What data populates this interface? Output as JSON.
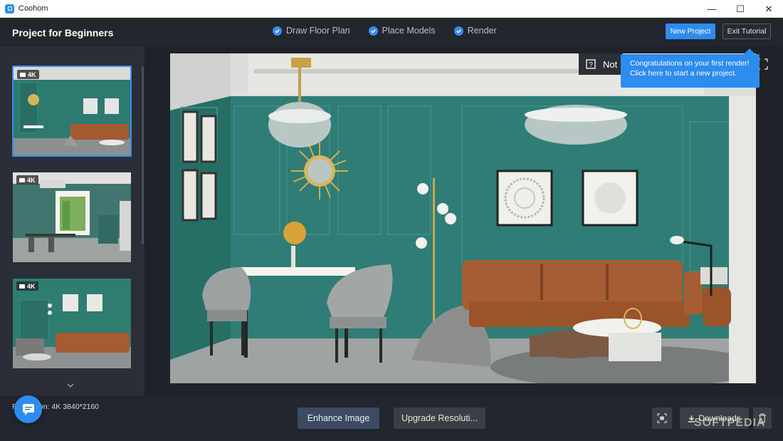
{
  "window": {
    "app_name": "Coohom",
    "minimize": "—",
    "maximize": "☐",
    "close": "✕"
  },
  "header": {
    "project_title": "Project for Beginners",
    "steps": [
      {
        "label": "Draw Floor Plan",
        "done": true
      },
      {
        "label": "Place Models",
        "done": true
      },
      {
        "label": "Render",
        "done": true
      }
    ],
    "new_project": "New Project",
    "exit_tutorial": "Exit Tutorial"
  },
  "sidebar": {
    "thumbnails": [
      {
        "badge": "4K",
        "selected": true
      },
      {
        "badge": "4K",
        "selected": false
      },
      {
        "badge": "4K",
        "selected": false
      }
    ],
    "more_icon": "chevron-down-icon"
  },
  "viewer": {
    "feedback_label": "Not",
    "tooltip_line1": "Congratulations on your first render!",
    "tooltip_line2": "Click here to start a new project."
  },
  "footer": {
    "resolution_label": "Resolution: 4K 3840*2160",
    "enhance_image": "Enhance Image",
    "upgrade_resolution": "Upgrade Resoluti...",
    "downloads": "Downloads",
    "watermark": "SOFTPEDIA"
  },
  "colors": {
    "accent": "#2d8cf0",
    "wall": "#2f7d74",
    "sofa": "#a05a30"
  }
}
